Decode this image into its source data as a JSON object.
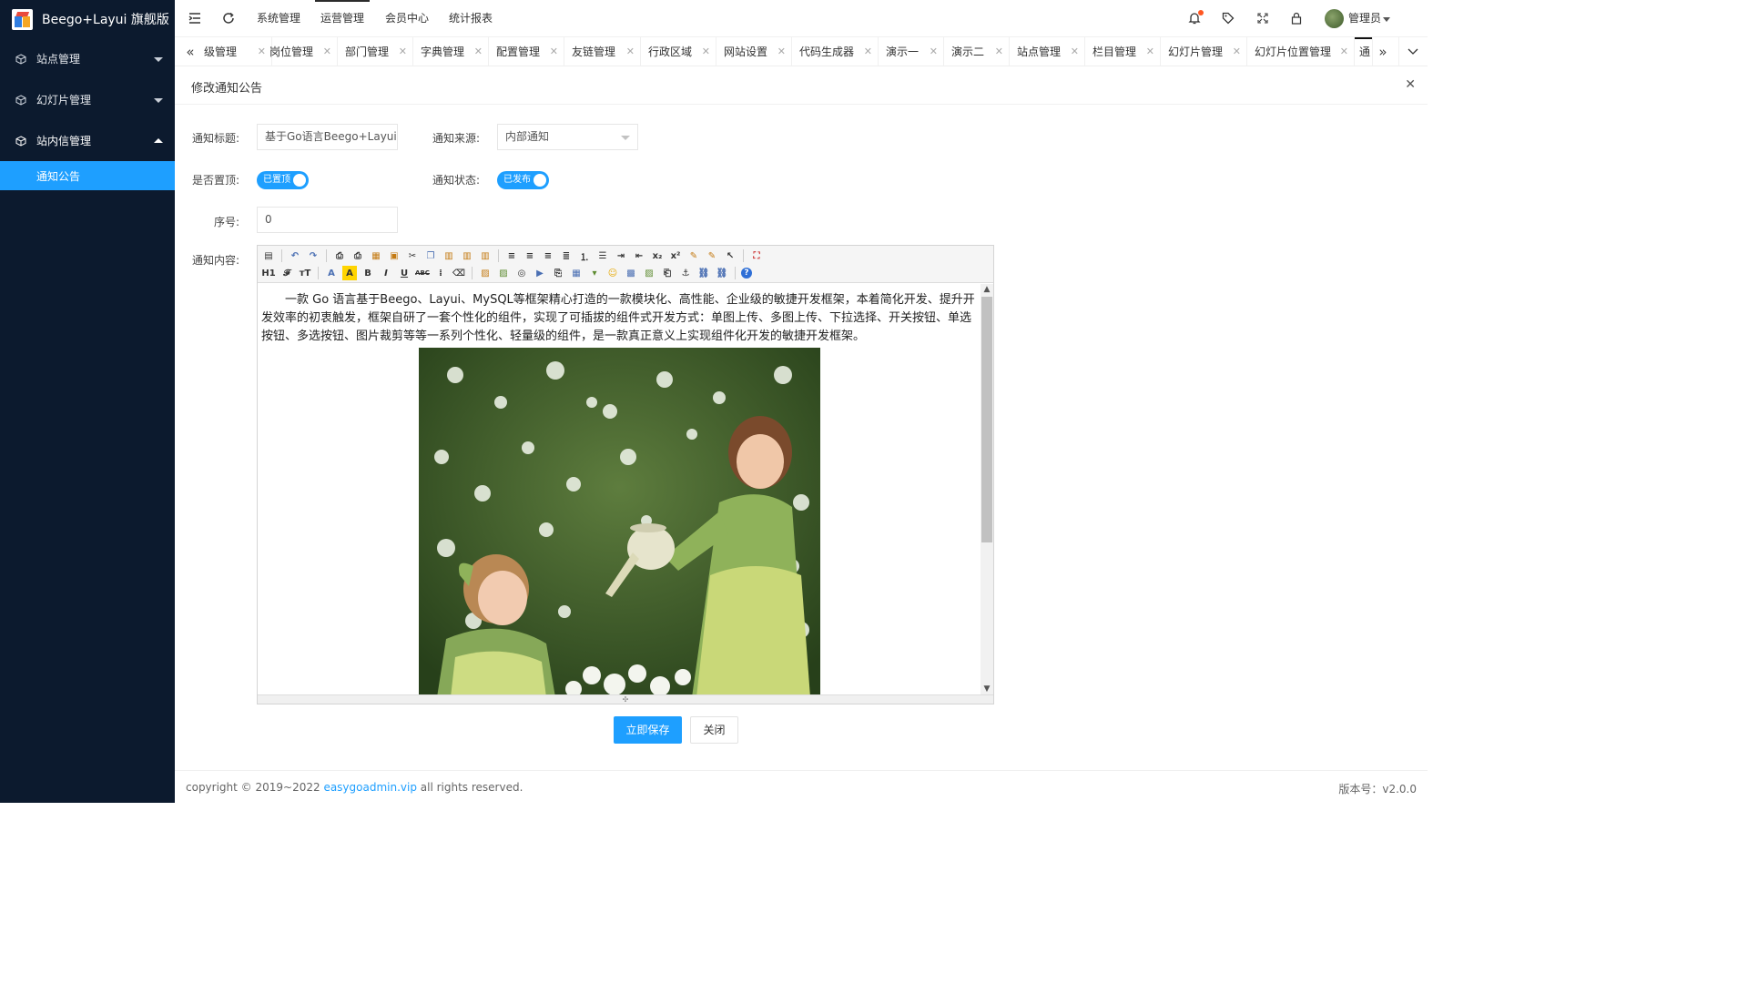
{
  "app": {
    "title": "Beego+Layui 旗舰版"
  },
  "sidebar": {
    "items": [
      {
        "label": "站点管理",
        "icon": "cube-icon",
        "expanded": false
      },
      {
        "label": "幻灯片管理",
        "icon": "cube-icon",
        "expanded": false
      },
      {
        "label": "站内信管理",
        "icon": "cube-icon",
        "expanded": true
      }
    ],
    "sub_items": [
      {
        "label": "通知公告",
        "active": true
      }
    ]
  },
  "header": {
    "nav": [
      "系统管理",
      "运营管理",
      "会员中心",
      "统计报表"
    ],
    "active_nav": "运营管理",
    "user": "管理员"
  },
  "tabs": [
    {
      "label": "级管理"
    },
    {
      "label": "岗位管理"
    },
    {
      "label": "部门管理"
    },
    {
      "label": "字典管理"
    },
    {
      "label": "配置管理"
    },
    {
      "label": "友链管理"
    },
    {
      "label": "行政区域"
    },
    {
      "label": "网站设置"
    },
    {
      "label": "代码生成器"
    },
    {
      "label": "演示一"
    },
    {
      "label": "演示二"
    },
    {
      "label": "站点管理"
    },
    {
      "label": "栏目管理"
    },
    {
      "label": "幻灯片管理"
    },
    {
      "label": "幻灯片位置管理"
    },
    {
      "label": "通"
    }
  ],
  "panel": {
    "title": "修改通知公告"
  },
  "form": {
    "title_label": "通知标题:",
    "title_value": "基于Go语言Beego+Layui敏捷",
    "source_label": "通知来源:",
    "source_value": "内部通知",
    "top_label": "是否置顶:",
    "top_switch": "已置顶",
    "status_label": "通知状态:",
    "status_switch": "已发布",
    "order_label": "序号:",
    "order_value": "0",
    "content_label": "通知内容:",
    "content_text": "一款 Go 语言基于Beego、Layui、MySQL等框架精心打造的一款模块化、高性能、企业级的敏捷开发框架，本着简化开发、提升开发效率的初衷触发，框架自研了一套个性化的组件，实现了可插拔的组件式开发方式：单图上传、多图上传、下拉选择、开关按钮、单选按钮、多选按钮、图片裁剪等等一系列个性化、轻量级的组件，是一款真正意义上实现组件化开发的敏捷开发框架。"
  },
  "buttons": {
    "save": "立即保存",
    "close": "关闭"
  },
  "footer": {
    "copyright_prefix": "copyright © 2019~2022 ",
    "copyright_link": "easygoadmin.vip",
    "copyright_suffix": " all rights reserved.",
    "version": "版本号：v2.0.0"
  },
  "colors": {
    "sidebar_bg": "#0c1a2e",
    "accent": "#1e9fff",
    "notification_dot": "#ff5722"
  }
}
